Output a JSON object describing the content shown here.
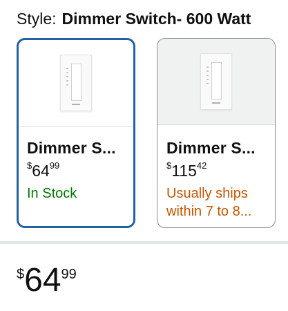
{
  "style_row": {
    "label": "Style:",
    "value": "Dimmer Switch- 600 Watt"
  },
  "options": [
    {
      "name": "Dimmer S...",
      "price_symbol": "$",
      "price_whole": "64",
      "price_fraction": "99",
      "availability": "In Stock",
      "selected": true,
      "image_icon": "dimmer-switch-image"
    },
    {
      "name": "Dimmer S...",
      "price_symbol": "$",
      "price_whole": "115",
      "price_fraction": "42",
      "availability": "Usually ships within 7 to 8...",
      "selected": false,
      "image_icon": "dimmer-switch-image"
    }
  ],
  "selected_price": {
    "symbol": "$",
    "whole": "64",
    "fraction": "99"
  },
  "colors": {
    "selected_border": "#2162a1",
    "in_stock": "#007600",
    "ships_later": "#c45500",
    "text": "#0f1111"
  }
}
